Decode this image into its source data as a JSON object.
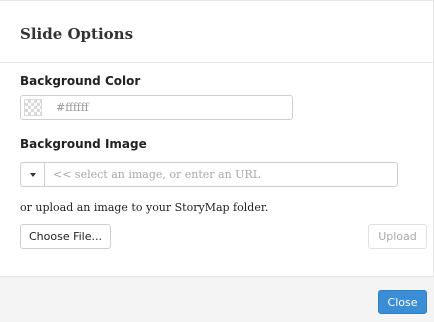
{
  "dialog": {
    "title": "Slide Options"
  },
  "background_color": {
    "label": "Background Color",
    "value": "#ffffff"
  },
  "background_image": {
    "label": "Background Image",
    "placeholder": "<< select an image, or enter an URL",
    "value": ""
  },
  "upload": {
    "text": "or upload an image to your StoryMap folder.",
    "choose_file_label": "Choose File...",
    "upload_label": "Upload"
  },
  "footer": {
    "close_label": "Close"
  },
  "colors": {
    "accent": "#3b8ed6"
  }
}
